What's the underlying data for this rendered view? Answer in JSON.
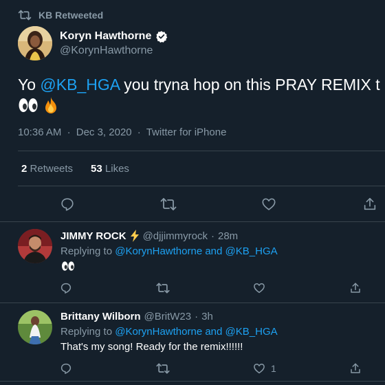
{
  "retweet_header": {
    "label": "KB Retweeted"
  },
  "tweet": {
    "author_name": "Koryn Hawthorne",
    "author_handle": "@KorynHawthorne",
    "text_prefix": "Yo ",
    "mention": "@KB_HGA",
    "text_suffix": " you tryna hop on this PRAY REMIX t",
    "emojis": [
      "eyes-emoji",
      "fire-emoji"
    ],
    "time": "10:36 AM",
    "date": "Dec 3, 2020",
    "source": "Twitter for iPhone",
    "separator": "·",
    "retweet_count": "2",
    "retweet_label": "Retweets",
    "like_count": "53",
    "like_label": "Likes"
  },
  "replies": [
    {
      "name": "JIMMY ROCK",
      "name_emoji": "lightning-emoji",
      "handle": "@djjimmyrock",
      "separator": "·",
      "time": "28m",
      "replying_prefix": "Replying to",
      "replying_user1": "@KorynHawthorne",
      "replying_and": "and",
      "replying_user2": "@KB_HGA",
      "body": "",
      "body_emoji": "eyes-emoji",
      "like_count": ""
    },
    {
      "name": "Brittany Wilborn",
      "handle": "@BritW23",
      "separator": "·",
      "time": "3h",
      "replying_prefix": "Replying to",
      "replying_user1": "@KorynHawthorne",
      "replying_and": "and",
      "replying_user2": "@KB_HGA",
      "body": "That's my song! Ready for the remix!!!!!!",
      "like_count": "1"
    }
  ],
  "colors": {
    "background": "#15202b",
    "text": "#ffffff",
    "muted": "#8899a6",
    "link": "#1da1f2",
    "divider": "#38444d"
  }
}
